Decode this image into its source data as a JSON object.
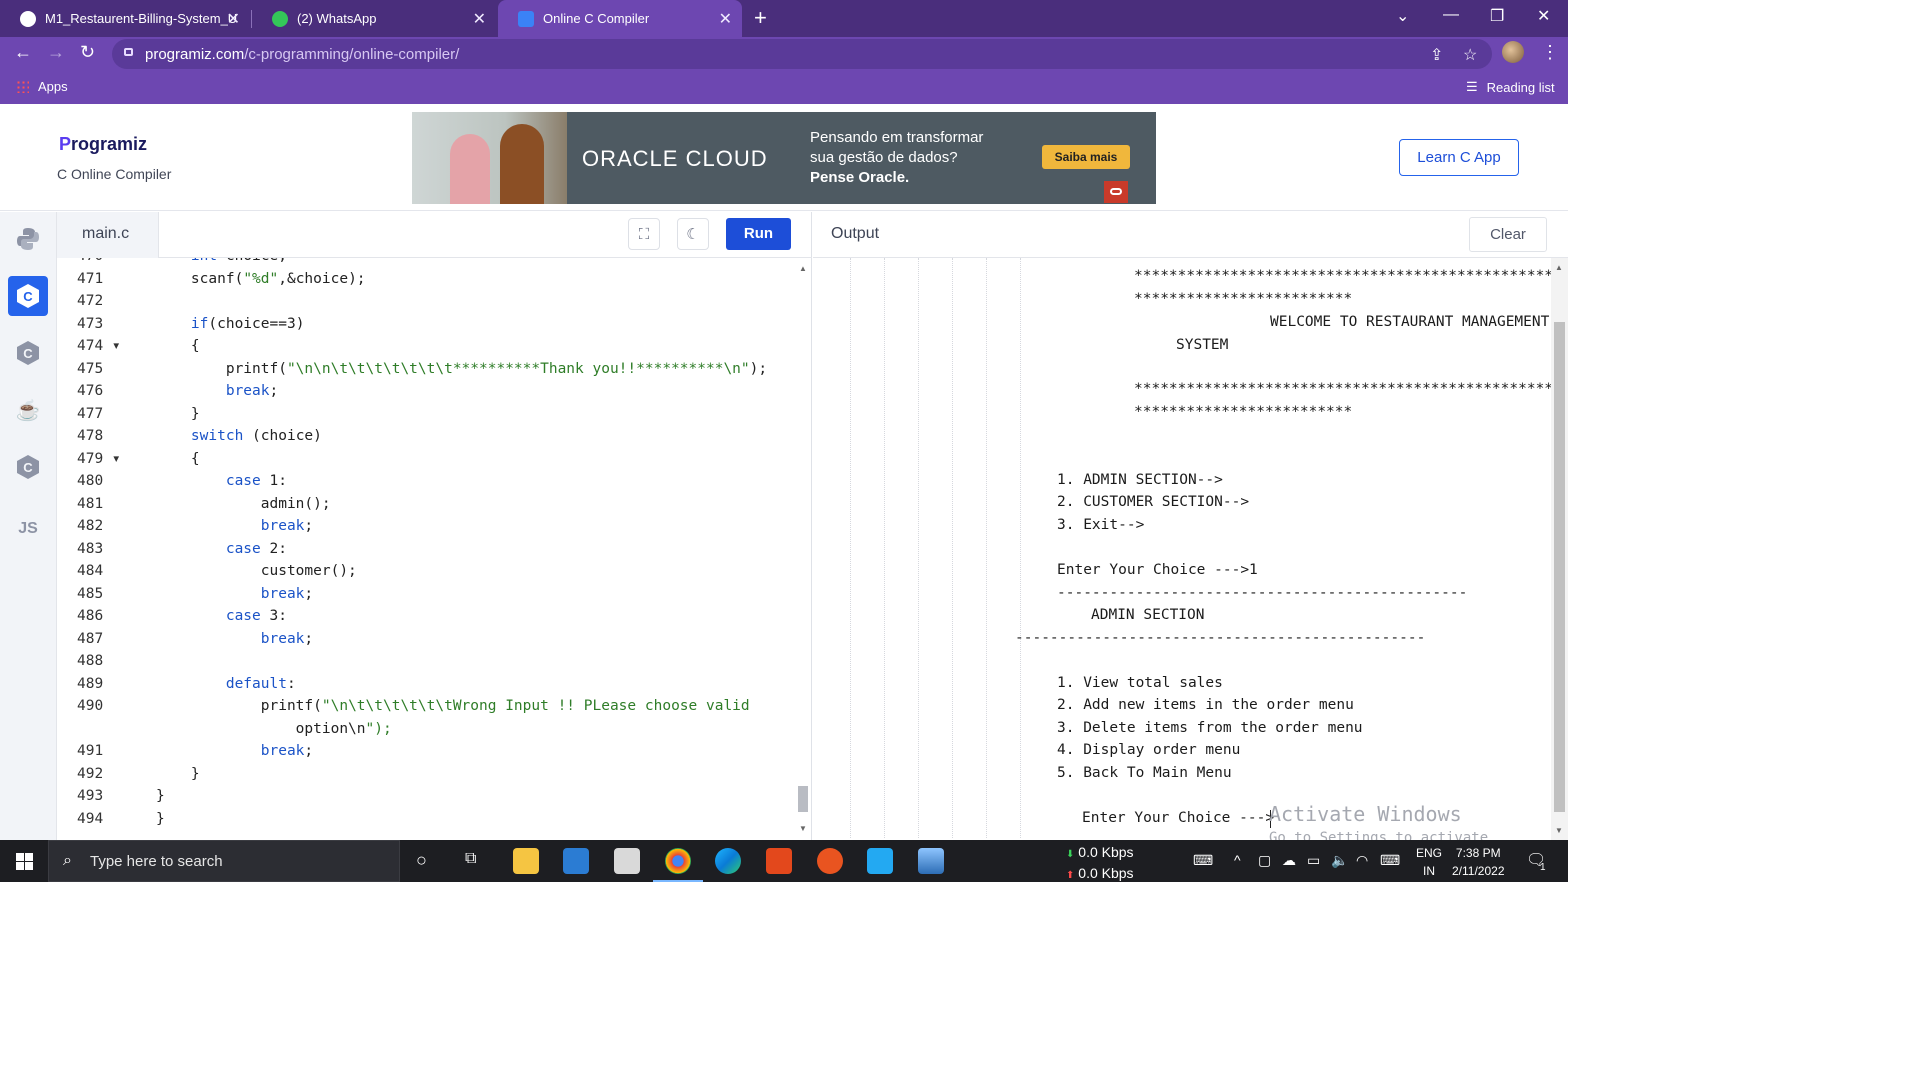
{
  "browser": {
    "tabs": [
      {
        "title": "M1_Restaurent-Billing-System_U",
        "icon": "github-icon"
      },
      {
        "title": "(2) WhatsApp",
        "icon": "whatsapp-icon"
      },
      {
        "title": "Online C Compiler",
        "icon": "programiz-icon",
        "active": true
      }
    ],
    "url_host": "programiz.com",
    "url_path": "/c-programming/online-compiler/",
    "bookmarks": {
      "apps": "Apps",
      "reading_list": "Reading list"
    }
  },
  "header": {
    "logo": "rogramiz",
    "logo_initial": "P",
    "subtitle": "C Online Compiler",
    "learn_button": "Learn C App",
    "ad": {
      "brand": "ORACLE CLOUD",
      "line1": "Pensando em transformar",
      "line2": "sua gestão de dados?",
      "line3": "Pense Oracle.",
      "cta": "Saiba mais"
    }
  },
  "sidebar": {
    "languages": [
      {
        "name": "python-icon",
        "label": ""
      },
      {
        "name": "c-icon",
        "label": "C",
        "active": true
      },
      {
        "name": "cpp-icon",
        "label": "C"
      },
      {
        "name": "java-icon",
        "label": "☕"
      },
      {
        "name": "csharp-icon",
        "label": "C"
      },
      {
        "name": "javascript-icon",
        "label": "JS"
      }
    ]
  },
  "editor": {
    "filename": "main.c",
    "run_label": "Run",
    "lines": [
      {
        "n": "470",
        "code": "    int choice;"
      },
      {
        "n": "471",
        "code": "    scanf(\"%d\",&choice);"
      },
      {
        "n": "472",
        "code": ""
      },
      {
        "n": "473",
        "code": "    if(choice==3)"
      },
      {
        "n": "474",
        "fold": true,
        "code": "    {"
      },
      {
        "n": "475",
        "code": "        printf(\"\\n\\n\\t\\t\\t\\t\\t\\t\\t**********Thank you!!**********\\n\");"
      },
      {
        "n": "476",
        "code": "        break;"
      },
      {
        "n": "477",
        "code": "    }"
      },
      {
        "n": "478",
        "code": "    switch (choice)"
      },
      {
        "n": "479",
        "fold": true,
        "code": "    {"
      },
      {
        "n": "480",
        "code": "        case 1:"
      },
      {
        "n": "481",
        "code": "            admin();"
      },
      {
        "n": "482",
        "code": "            break;"
      },
      {
        "n": "483",
        "code": "        case 2:"
      },
      {
        "n": "484",
        "code": "            customer();"
      },
      {
        "n": "485",
        "code": "            break;"
      },
      {
        "n": "486",
        "code": "        case 3:"
      },
      {
        "n": "487",
        "code": "            break;"
      },
      {
        "n": "488",
        "code": ""
      },
      {
        "n": "489",
        "code": "        default:"
      },
      {
        "n": "490",
        "code": "            printf(\"\\n\\t\\t\\t\\t\\t\\tWrong Input !! PLease choose valid"
      },
      {
        "n": "",
        "code": "                option\\n\");"
      },
      {
        "n": "491",
        "code": "            break;"
      },
      {
        "n": "492",
        "code": "    }"
      },
      {
        "n": "493",
        "code": "}"
      },
      {
        "n": "494",
        "code": "}"
      }
    ]
  },
  "output": {
    "label": "Output",
    "clear_label": "Clear",
    "lines": [
      "*************************************************",
      "*************************",
      "WELCOME TO RESTAURANT MANAGEMENT",
      "SYSTEM",
      "*************************************************",
      "*************************",
      "1. ADMIN SECTION-->",
      "2. CUSTOMER SECTION-->",
      "3. Exit-->",
      "Enter Your Choice --->1",
      "-----------------------------------------------",
      "ADMIN SECTION",
      "-----------------------------------------------",
      "1. View total sales",
      "2. Add new items in the order menu",
      "3. Delete items from the order menu",
      "4. Display order menu",
      "5. Back To Main Menu",
      "Enter Your Choice --->"
    ],
    "watermark_title": "Activate Windows",
    "watermark_sub": "Go to Settings to activate Windows."
  },
  "taskbar": {
    "search_placeholder": "Type here to search",
    "net_down": "0.0 Kbps",
    "net_up": "0.0 Kbps",
    "lang_line1": "ENG",
    "lang_line2": "IN",
    "time": "7:38 PM",
    "date": "2/11/2022",
    "notification_count": "1"
  }
}
